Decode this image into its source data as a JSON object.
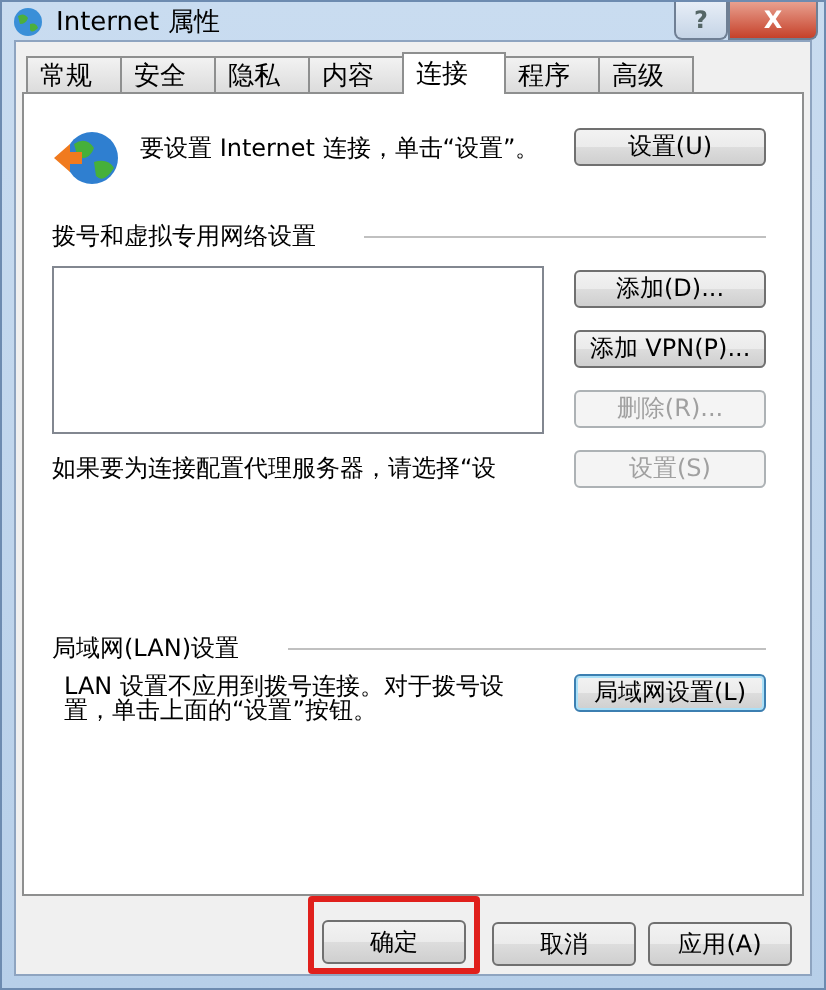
{
  "window": {
    "title": "Internet 属性",
    "controls": [
      {
        "kind": "help",
        "label": "?"
      },
      {
        "kind": "close",
        "label": "X"
      }
    ]
  },
  "tabs": [
    {
      "label": "常规",
      "selected": false
    },
    {
      "label": "安全",
      "selected": false
    },
    {
      "label": "隐私",
      "selected": false
    },
    {
      "label": "内容",
      "selected": false
    },
    {
      "label": "连接",
      "selected": true
    },
    {
      "label": "程序",
      "selected": false
    },
    {
      "label": "高级",
      "selected": false
    }
  ],
  "setup": {
    "text": "要设置 Internet 连接，单击“设置”。",
    "button": {
      "label": "设置(U)",
      "disabled": false
    }
  },
  "dialup": {
    "heading": "拨号和虚拟专用网络设置",
    "buttons": [
      {
        "label": "添加(D)...",
        "disabled": false
      },
      {
        "label": "添加 VPN(P)...",
        "disabled": false
      },
      {
        "label": "删除(R)...",
        "disabled": true
      }
    ],
    "proxy_text": "如果要为连接配置代理服务器，请选择“设",
    "proxy_button": {
      "label": "设置(S)",
      "disabled": true
    }
  },
  "lan": {
    "heading": "局域网(LAN)设置",
    "text": "LAN 设置不应用到拨号连接。对于拨号设置，单击上面的“设置”按钮。",
    "button": {
      "label": "局域网设置(L)",
      "disabled": false,
      "focused": true
    }
  },
  "footer": [
    {
      "label": "确定",
      "highlighted": true
    },
    {
      "label": "取消",
      "highlighted": false
    },
    {
      "label": "应用(A)",
      "highlighted": false
    }
  ]
}
